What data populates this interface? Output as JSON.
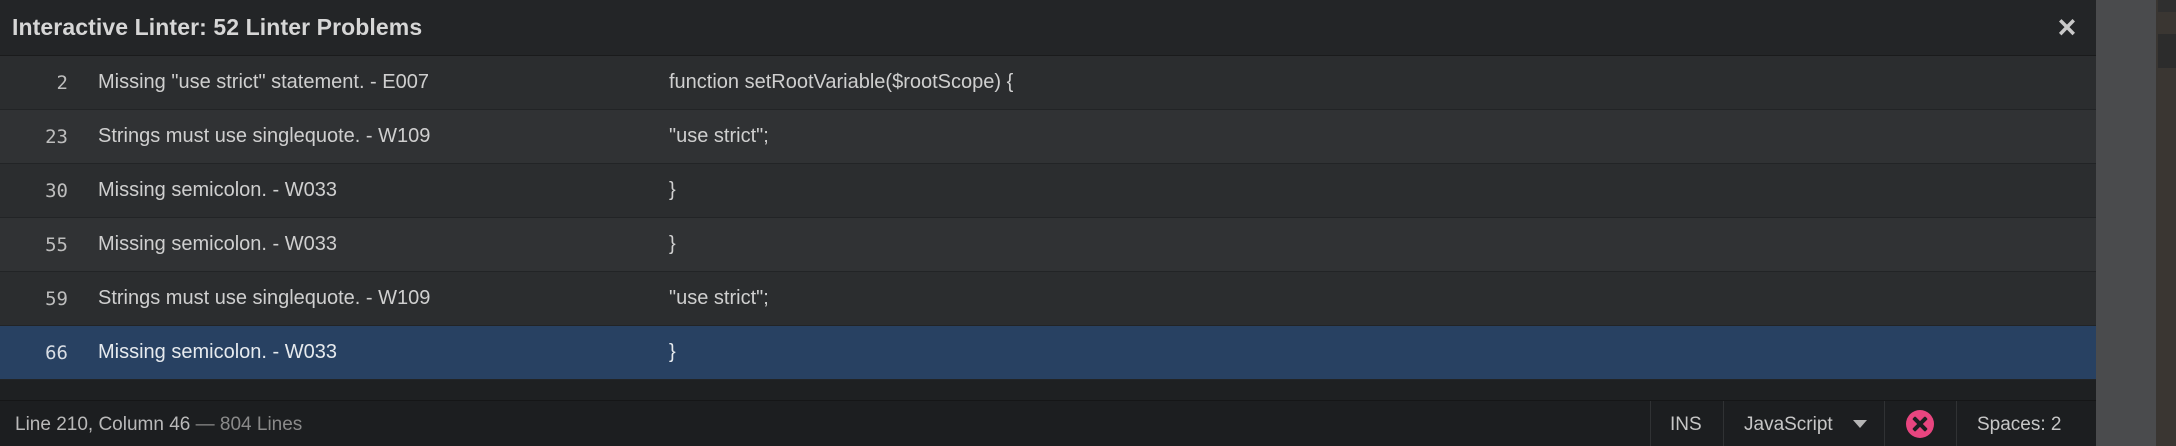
{
  "panel": {
    "title": "Interactive Linter: 52 Linter Problems",
    "close_glyph": "×"
  },
  "problems": [
    {
      "line": "2",
      "message": "Missing \"use strict\" statement. - E007",
      "code": "function setRootVariable($rootScope) {"
    },
    {
      "line": "23",
      "message": "Strings must use singlequote. - W109",
      "code": "\"use strict\";"
    },
    {
      "line": "30",
      "message": "Missing semicolon. - W033",
      "code": "}"
    },
    {
      "line": "55",
      "message": "Missing semicolon. - W033",
      "code": "}"
    },
    {
      "line": "59",
      "message": "Strings must use singlequote. - W109",
      "code": "\"use strict\";"
    },
    {
      "line": "66",
      "message": "Missing semicolon. - W033",
      "code": "}",
      "selected": true
    }
  ],
  "status": {
    "position": "Line 210, Column 46",
    "lines": " — 804 Lines",
    "mode": "INS",
    "language": "JavaScript",
    "error_icon": "error-circle-icon",
    "spaces": "Spaces:  2"
  },
  "colors": {
    "selected_row": "#284162",
    "error_badge": "#e8457f"
  }
}
